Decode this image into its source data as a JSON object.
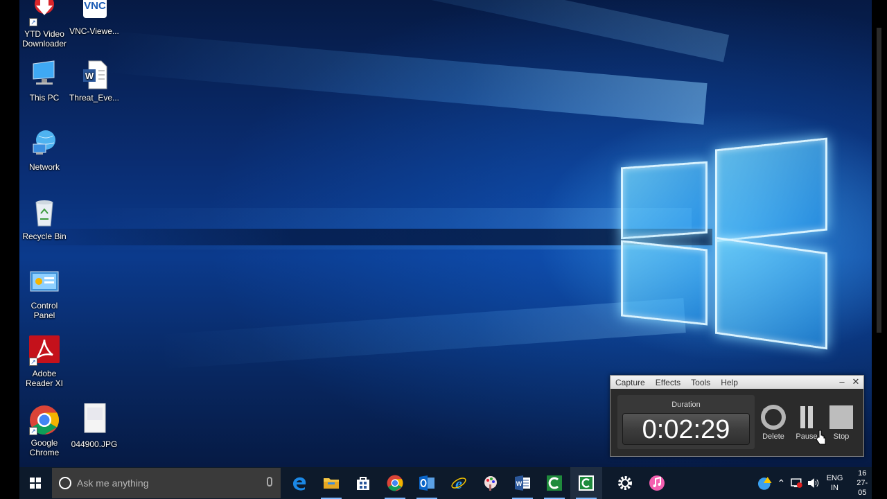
{
  "desktop": {
    "icons": [
      {
        "name": "YTD Video Downloader",
        "line1": "YTD Video",
        "line2": "Downloader"
      },
      {
        "name": "VNC-Viewer",
        "line1": "VNC-Viewe...",
        "line2": ""
      },
      {
        "name": "This PC",
        "line1": "This PC",
        "line2": ""
      },
      {
        "name": "Threat_Eve",
        "line1": "Threat_Eve...",
        "line2": ""
      },
      {
        "name": "Network",
        "line1": "Network",
        "line2": ""
      },
      {
        "name": "Recycle Bin",
        "line1": "Recycle Bin",
        "line2": ""
      },
      {
        "name": "Control Panel",
        "line1": "Control",
        "line2": "Panel"
      },
      {
        "name": "Adobe Reader XI",
        "line1": "Adobe",
        "line2": "Reader XI"
      },
      {
        "name": "Google Chrome",
        "line1": "Google",
        "line2": "Chrome"
      },
      {
        "name": "044900.JPG",
        "line1": "044900.JPG",
        "line2": ""
      }
    ],
    "vnc_glyph": "VNC"
  },
  "recorder": {
    "menu": [
      "Capture",
      "Effects",
      "Tools",
      "Help"
    ],
    "minimize": "–",
    "close": "✕",
    "duration_label": "Duration",
    "timer": "0:02:29",
    "delete_label": "Delete",
    "pause_label": "Pause",
    "stop_label": "Stop"
  },
  "taskbar": {
    "search_placeholder": "Ask me anything",
    "pinned": [
      "edge-icon",
      "file-explorer-icon",
      "store-icon",
      "chrome-icon",
      "outlook-icon",
      "internet-explorer-icon",
      "paint-icon",
      "word-icon",
      "camtasia-studio-icon",
      "camtasia-recorder-icon",
      "settings-icon",
      "itunes-icon"
    ],
    "lang_line1": "ENG",
    "lang_line2": "IN",
    "time": "16",
    "date": "27-05"
  },
  "colors": {
    "taskbar_bg": "#0d1a2b",
    "search_bg": "#3a3a3a",
    "recorder_bg": "#2b2b2b"
  }
}
